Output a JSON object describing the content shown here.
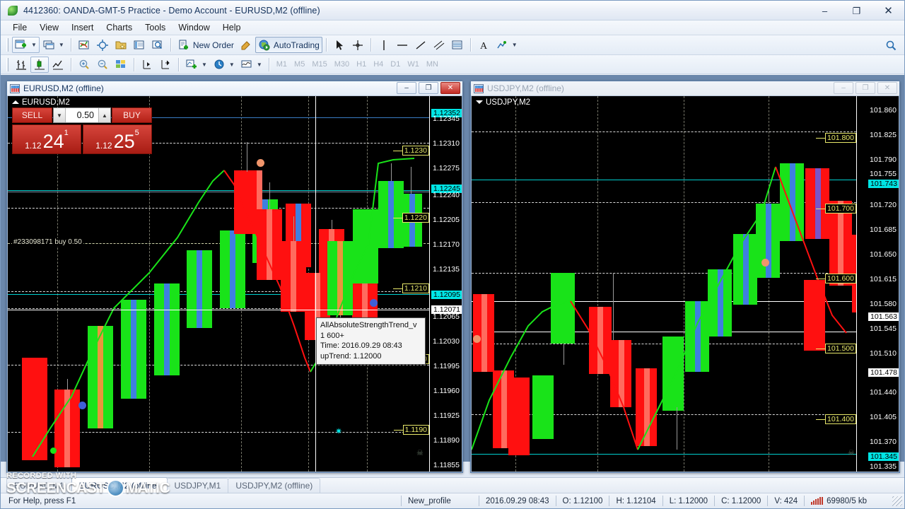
{
  "window": {
    "title": "4412360: OANDA-GMT-5 Practice - Demo Account - EURUSD,M2 (offline)",
    "minimize": "–",
    "maximize": "❐",
    "close": "✕"
  },
  "menu": [
    "File",
    "View",
    "Insert",
    "Charts",
    "Tools",
    "Window",
    "Help"
  ],
  "toolbar_main": {
    "new_chart": "new-chart",
    "profiles": "profiles",
    "market_watch": "market-watch",
    "data_window": "data-window",
    "navigator": "navigator",
    "terminal": "terminal",
    "strategy_tester": "strategy-tester",
    "new_order_label": "New Order",
    "metaeditor": "metaeditor",
    "autotrading_label": "AutoTrading",
    "cursor": "cursor",
    "crosshair": "crosshair",
    "vertical_line": "vertical-line",
    "horizontal_line": "horizontal-line",
    "trendline": "trendline",
    "equidistant": "equidistant-channel",
    "fibo": "fibonacci",
    "text": "text-label",
    "objects_label": "objects"
  },
  "toolbar_chart": {
    "bar_chart": "bar-chart",
    "candlestick": "candlestick-chart",
    "line_chart": "line-chart",
    "zoom_in": "zoom-in",
    "zoom_out": "zoom-out",
    "tile_windows": "tile-windows",
    "auto_scroll": "auto-scroll",
    "chart_shift": "chart-shift",
    "indicators": "indicators",
    "periods": "periods",
    "templates": "templates",
    "timeframes": [
      "M1",
      "M5",
      "M15",
      "M30",
      "H1",
      "H4",
      "D1",
      "W1",
      "MN"
    ],
    "search": "search"
  },
  "charts": [
    {
      "id": "eurusd",
      "window_title": "EURUSD,M2 (offline)",
      "symbol_label": "EURUSD,M2",
      "active": true,
      "buttons": {
        "minimize": "–",
        "restore": "❐",
        "close": "✕"
      },
      "trade_panel": {
        "sell_label": "SELL",
        "buy_label": "BUY",
        "volume": "0.50",
        "spin_down": "▼",
        "spin_up": "▲",
        "sell_big": "24",
        "sell_small": "1.12",
        "sell_sup": "1",
        "buy_big": "25",
        "buy_small": "1.12",
        "buy_sup": "5"
      },
      "order_label": "#233098171 buy 0.50",
      "y_ticks": [
        "1.12345",
        "1.12310",
        "1.12275",
        "1.12240",
        "1.12205",
        "1.12170",
        "1.12135",
        "1.12065",
        "1.12030",
        "1.11995",
        "1.11960",
        "1.11925",
        "1.11890",
        "1.11855"
      ],
      "highlight_ticks": [
        {
          "value": "1.12352",
          "type": "cyan"
        },
        {
          "value": "1.12245",
          "type": "cyan"
        },
        {
          "value": "1.12095",
          "type": "cyan"
        },
        {
          "value": "1.12071",
          "type": "white"
        }
      ],
      "price_tags": [
        "1.1230",
        "1.1220",
        "1.1210",
        "1.1200",
        "1.1190"
      ],
      "tooltip": {
        "line1": "AllAbsoluteStrengthTrend_v",
        "line2": "1 600+",
        "line3": "Time: 2016.09.29 08:43",
        "line4": "upTrend: 1.12000"
      }
    },
    {
      "id": "usdjpy",
      "window_title": "USDJPY,M2 (offline)",
      "symbol_label": "USDJPY,M2",
      "active": false,
      "buttons": {
        "minimize": "–",
        "restore": "❐",
        "close": "✕"
      },
      "y_ticks": [
        "101.860",
        "101.825",
        "101.790",
        "101.755",
        "101.720",
        "101.685",
        "101.650",
        "101.615",
        "101.580",
        "101.545",
        "101.510",
        "101.440",
        "101.405",
        "101.370",
        "101.335"
      ],
      "highlight_ticks": [
        {
          "value": "101.743",
          "type": "cyan"
        },
        {
          "value": "101.563",
          "type": "white"
        },
        {
          "value": "101.478",
          "type": "white"
        },
        {
          "value": "101.345",
          "type": "cyan"
        }
      ],
      "price_tags": [
        "101.800",
        "101.700",
        "101.600",
        "101.500",
        "101.400"
      ]
    }
  ],
  "chart_tabs": [
    {
      "label": "EURUSD,M1",
      "active": false
    },
    {
      "label": "EURUSD,M2 (offline)",
      "active": true
    },
    {
      "label": "USDJPY,M1",
      "active": false
    },
    {
      "label": "USDJPY,M2 (offline)",
      "active": false
    }
  ],
  "statusbar": {
    "help": "For Help, press F1",
    "profile": "New_profile",
    "time": "2016.09.29 08:43",
    "open": "O: 1.12100",
    "high": "H: 1.12104",
    "low": "L: 1.12000",
    "close": "C: 1.12000",
    "volume": "V: 424",
    "traffic": "69980/5 kb"
  },
  "watermark": {
    "top": "RECORDED WITH",
    "left": "SCREENCAST",
    "right": "MATIC"
  },
  "chart_data": {
    "type": "candlestick",
    "charts": [
      {
        "symbol": "EURUSD",
        "timeframe": "M2",
        "offline": true,
        "ylim": [
          1.11855,
          1.12352
        ],
        "yticks": [
          1.12345,
          1.1231,
          1.12275,
          1.1224,
          1.12205,
          1.1217,
          1.12135,
          1.12065,
          1.1203,
          1.11995,
          1.1196,
          1.11925,
          1.1189,
          1.11855
        ],
        "bid": 1.12241,
        "ask": 1.12255,
        "indicator": "AllAbsoluteStrengthTrend_v1 600+",
        "last_bar": {
          "time": "2016.09.29 08:43",
          "open": 1.121,
          "high": 1.12104,
          "low": 1.12,
          "close": 1.12,
          "volume": 424
        },
        "bars": [
          {
            "open": 1.12,
            "close": 1.11935,
            "dir": "down",
            "stripe": "light"
          },
          {
            "open": 1.11935,
            "close": 1.1188,
            "dir": "down",
            "stripe": "light"
          },
          {
            "open": 1.1188,
            "close": 1.1199,
            "dir": "up",
            "stripe": "orange"
          },
          {
            "open": 1.1199,
            "close": 1.1207,
            "dir": "up",
            "stripe": "blue"
          },
          {
            "open": 1.1207,
            "close": 1.1214,
            "dir": "up",
            "stripe": "blue"
          },
          {
            "open": 1.1214,
            "close": 1.12215,
            "dir": "up",
            "stripe": "blue"
          },
          {
            "open": 1.12215,
            "close": 1.1227,
            "dir": "up",
            "stripe": "blue"
          },
          {
            "open": 1.1227,
            "close": 1.12315,
            "dir": "up",
            "stripe": "blue"
          },
          {
            "open": 1.12315,
            "close": 1.12352,
            "dir": "up",
            "stripe": "blue"
          },
          {
            "open": 1.12352,
            "close": 1.1226,
            "dir": "down",
            "stripe": "blue"
          },
          {
            "open": 1.1226,
            "close": 1.12165,
            "dir": "down",
            "stripe": "light"
          },
          {
            "open": 1.12165,
            "close": 1.1209,
            "dir": "down",
            "stripe": "light"
          },
          {
            "open": 1.1209,
            "close": 1.12,
            "dir": "down",
            "stripe": "light"
          },
          {
            "open": 1.12,
            "close": 1.121,
            "dir": "up",
            "stripe": "orange"
          },
          {
            "open": 1.121,
            "close": 1.12215,
            "dir": "up",
            "stripe": "none"
          },
          {
            "open": 1.12215,
            "close": 1.1228,
            "dir": "up",
            "stripe": "blue"
          },
          {
            "open": 1.1228,
            "close": 1.1224,
            "dir": "up",
            "stripe": "blue"
          }
        ]
      },
      {
        "symbol": "USDJPY",
        "timeframe": "M2",
        "offline": true,
        "ylim": [
          101.335,
          101.86
        ],
        "yticks": [
          101.86,
          101.825,
          101.79,
          101.755,
          101.72,
          101.685,
          101.65,
          101.615,
          101.58,
          101.545,
          101.51,
          101.44,
          101.405,
          101.37,
          101.335
        ],
        "bid": 101.743,
        "bars": [
          {
            "open": 101.51,
            "close": 101.43,
            "dir": "down",
            "stripe": "light"
          },
          {
            "open": 101.43,
            "close": 101.345,
            "dir": "down",
            "stripe": "light"
          },
          {
            "open": 101.345,
            "close": 101.48,
            "dir": "up",
            "stripe": "none"
          },
          {
            "open": 101.48,
            "close": 101.56,
            "dir": "up",
            "stripe": "none"
          },
          {
            "open": 101.56,
            "close": 101.505,
            "dir": "down",
            "stripe": "light"
          },
          {
            "open": 101.505,
            "close": 101.45,
            "dir": "down",
            "stripe": "light"
          },
          {
            "open": 101.45,
            "close": 101.4,
            "dir": "down",
            "stripe": "light"
          },
          {
            "open": 101.4,
            "close": 101.495,
            "dir": "up",
            "stripe": "none"
          },
          {
            "open": 101.495,
            "close": 101.57,
            "dir": "up",
            "stripe": "blue"
          },
          {
            "open": 101.57,
            "close": 101.64,
            "dir": "up",
            "stripe": "blue"
          },
          {
            "open": 101.64,
            "close": 101.72,
            "dir": "up",
            "stripe": "blue"
          },
          {
            "open": 101.72,
            "close": 101.79,
            "dir": "up",
            "stripe": "blue"
          },
          {
            "open": 101.79,
            "close": 101.83,
            "dir": "up",
            "stripe": "blue"
          },
          {
            "open": 101.83,
            "close": 101.745,
            "dir": "down",
            "stripe": "blue"
          },
          {
            "open": 101.745,
            "close": 101.66,
            "dir": "down",
            "stripe": "light"
          },
          {
            "open": 101.66,
            "close": 101.59,
            "dir": "down",
            "stripe": "light"
          },
          {
            "open": 101.59,
            "close": 101.545,
            "dir": "down",
            "stripe": "light"
          }
        ]
      }
    ]
  }
}
